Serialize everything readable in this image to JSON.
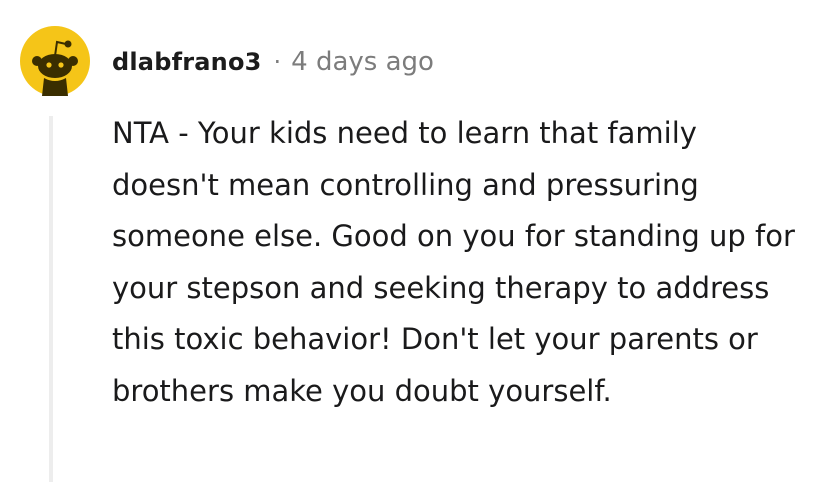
{
  "comment": {
    "username": "dlabfrano3",
    "separator": "·",
    "timestamp": "4 days ago",
    "avatar_icon": "reddit-snoo-avatar-icon",
    "avatar_color": "#f5c518",
    "body": "NTA - Your kids need to learn that family doesn't mean controlling and pressuring someone else. Good on you for standing up for your stepson and seeking therapy to address this toxic behavior! Don't let your parents or brothers make you doubt yourself."
  }
}
